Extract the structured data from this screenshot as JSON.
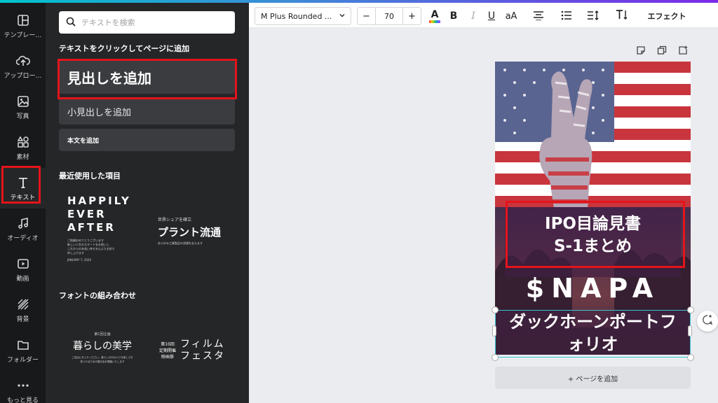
{
  "sidebar": {
    "items": [
      {
        "label": "テンプレー…",
        "icon": "layout-icon"
      },
      {
        "label": "アップロー…",
        "icon": "cloud-upload-icon"
      },
      {
        "label": "写真",
        "icon": "photo-icon"
      },
      {
        "label": "素材",
        "icon": "elements-icon"
      },
      {
        "label": "テキスト",
        "icon": "text-icon"
      },
      {
        "label": "オーディオ",
        "icon": "music-note-icon"
      },
      {
        "label": "動画",
        "icon": "video-icon"
      },
      {
        "label": "背景",
        "icon": "background-icon"
      },
      {
        "label": "フォルダー",
        "icon": "folder-icon"
      },
      {
        "label": "もっと見る",
        "icon": "more-icon"
      }
    ],
    "active_index": 4
  },
  "panel": {
    "search_placeholder": "テキストを検索",
    "add_section_title": "テキストをクリックしてページに追加",
    "heading_button": "見出しを追加",
    "subheading_button": "小見出しを追加",
    "body_button": "本文を追加",
    "recent_title": "最近使用した項目",
    "font_combo_title": "フォントの組み合わせ",
    "recent_samples": {
      "happily": {
        "lines": [
          "HAPPILY",
          "EVER",
          "AFTER"
        ],
        "small_lines": [
          "ご結婚おめでとうございます",
          "新しい人生のスタートをお祝いし",
          "これからの末長い幸せを心よりお祈り",
          "申し上げます"
        ],
        "date": "JANUARY 7, 2020"
      },
      "plant": {
        "kicker": "世界シェアを確立",
        "title": "プラント流通",
        "small": "あらゆる工業製品の流通を支えます"
      }
    },
    "combo_samples": {
      "kurashi": {
        "small_top": "第1回企画",
        "title": "暮らしの美学",
        "small_bottom": [
          "ご自由にお入りください。暮らしの中の小さな美しさを",
          "見つけるための展示会を開催いたします"
        ]
      },
      "festa": {
        "small": [
          "第16回",
          "定期開催",
          "映画祭"
        ],
        "title_lines": [
          "フィルム",
          "フェスタ"
        ]
      }
    }
  },
  "toolbar": {
    "font_name": "M Plus Rounded ...",
    "minus": "−",
    "font_size": "70",
    "plus": "+",
    "text_color_label": "A",
    "bold_label": "B",
    "italic_label": "I",
    "underline_label": "U",
    "case_label": "aA",
    "effects_label": "エフェクト",
    "text_color_bar": "#ff4d4d"
  },
  "canvas": {
    "title_lines": [
      "IPO目論見書",
      "S-1まとめ"
    ],
    "ticker": "$NAPA",
    "company_lines": [
      "ダックホーンポートフ",
      "ォリオ"
    ],
    "add_page_label": "+ ページを追加"
  },
  "colors": {
    "accent_red": "#e4141b",
    "selection": "#36c6d3",
    "panel_bg": "#252627",
    "rail_bg": "#18191b"
  }
}
